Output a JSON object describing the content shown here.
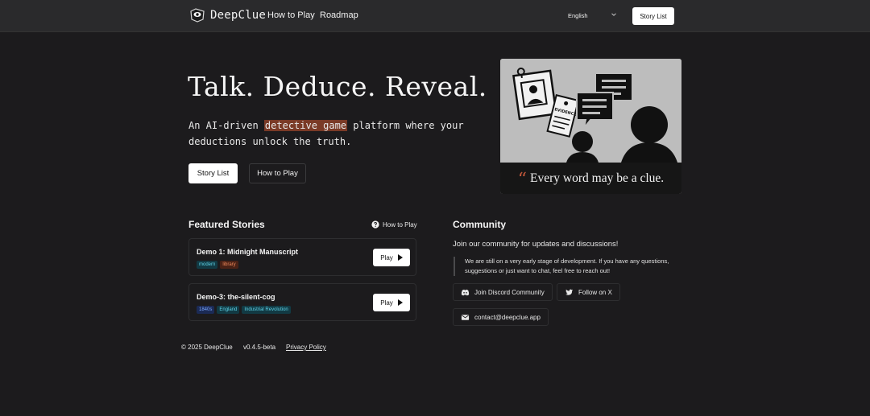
{
  "nav": {
    "brand": "DeepClue",
    "links": [
      "How to Play",
      "Roadmap"
    ],
    "language": "English",
    "story_list_button": "Story List"
  },
  "hero": {
    "title": "Talk. Deduce. Reveal.",
    "subtitle_before": "An AI-driven ",
    "subtitle_highlight": "detective game",
    "subtitle_after": " platform where your deductions unlock the truth.",
    "primary_button": "Story List",
    "secondary_button": "How to Play",
    "image_badge": "EVIDENCE",
    "image_caption": "Every word may be a clue."
  },
  "featured": {
    "title": "Featured Stories",
    "help_link": "How to Play",
    "stories": [
      {
        "title": "Demo 1: Midnight Manuscript",
        "tags": [
          {
            "label": "modern",
            "color": "#5fd4e8",
            "bg": "#123a44"
          },
          {
            "label": "library",
            "color": "#f08a5c",
            "bg": "#4a2216"
          }
        ],
        "play": "Play"
      },
      {
        "title": "Demo-3: the-silent-cog",
        "tags": [
          {
            "label": "1840s",
            "color": "#7aa8ff",
            "bg": "#1b2a55"
          },
          {
            "label": "England",
            "color": "#5fd4e8",
            "bg": "#123a44"
          },
          {
            "label": "Industrial Revolution",
            "color": "#5fd4e8",
            "bg": "#123a44"
          }
        ],
        "play": "Play"
      }
    ]
  },
  "community": {
    "title": "Community",
    "subtitle": "Join our community for updates and discussions!",
    "quote": "We are still on a very early stage of development. If you have any questions, suggestions or just want to chat, feel free to reach out!",
    "discord": "Join Discord Community",
    "x": "Follow on X",
    "email": "contact@deepclue.app"
  },
  "footer": {
    "copyright": "© 2025 DeepClue",
    "version": "v0.4.5-beta",
    "privacy": "Privacy Policy"
  }
}
